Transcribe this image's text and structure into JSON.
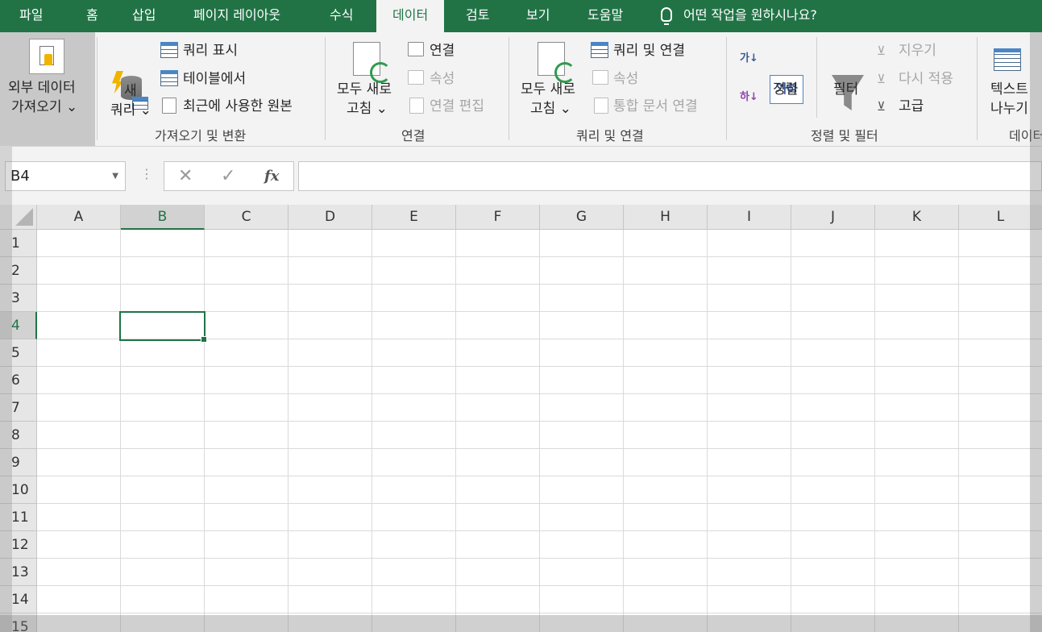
{
  "tabs": [
    {
      "label": "파일",
      "active": false
    },
    {
      "label": "홈",
      "active": false
    },
    {
      "label": "삽입",
      "active": false
    },
    {
      "label": "페이지 레이아웃",
      "active": false
    },
    {
      "label": "수식",
      "active": false
    },
    {
      "label": "데이터",
      "active": true
    },
    {
      "label": "검토",
      "active": false
    },
    {
      "label": "보기",
      "active": false
    },
    {
      "label": "도움말",
      "active": false
    }
  ],
  "tell_me": "어떤 작업을 원하시나요?",
  "ribbon": {
    "external_data": {
      "line1": "외부 데이터",
      "line2": "가져오기 ⌄"
    },
    "get_transform": {
      "new_query_line1": "새",
      "new_query_line2": "쿼리 ⌄",
      "show_queries": "쿼리 표시",
      "from_table": "테이블에서",
      "recent_sources": "최근에 사용한 원본",
      "group_label": "가져오기 및 변환"
    },
    "connections": {
      "refresh_line1": "모두 새로",
      "refresh_line2": "고침 ⌄",
      "connections": "연결",
      "properties": "속성",
      "edit_links": "연결 편집",
      "group_label": "연결"
    },
    "queries_connections": {
      "refresh_line1": "모두 새로",
      "refresh_line2": "고침 ⌄",
      "queries_connections": "쿼리 및 연결",
      "properties": "속성",
      "edit_links": "통합 문서 연결",
      "group_label": "쿼리 및 연결"
    },
    "sort_filter": {
      "sort": "정렬",
      "filter": "필터",
      "clear": "지우기",
      "reapply": "다시 적용",
      "advanced": "고급",
      "group_label": "정렬 및 필터",
      "sort_az_glyph": "가↓",
      "sort_za_glyph": "하↓",
      "sort_box_glyph": "가하"
    },
    "data_tools": {
      "text_to_columns_line1": "텍스트",
      "text_to_columns_line2": "나누기",
      "group_label": "데이터"
    }
  },
  "formula_bar": {
    "name_box": "B4",
    "cancel": "✕",
    "enter": "✓",
    "fx": "fx",
    "formula": ""
  },
  "columns": [
    "A",
    "B",
    "C",
    "D",
    "E",
    "F",
    "G",
    "H",
    "I",
    "J",
    "K",
    "L"
  ],
  "rows": [
    "1",
    "2",
    "3",
    "4",
    "5",
    "6",
    "7",
    "8",
    "9",
    "10",
    "11",
    "12",
    "13",
    "14",
    "15"
  ],
  "selected": {
    "column": "B",
    "row": "4"
  }
}
